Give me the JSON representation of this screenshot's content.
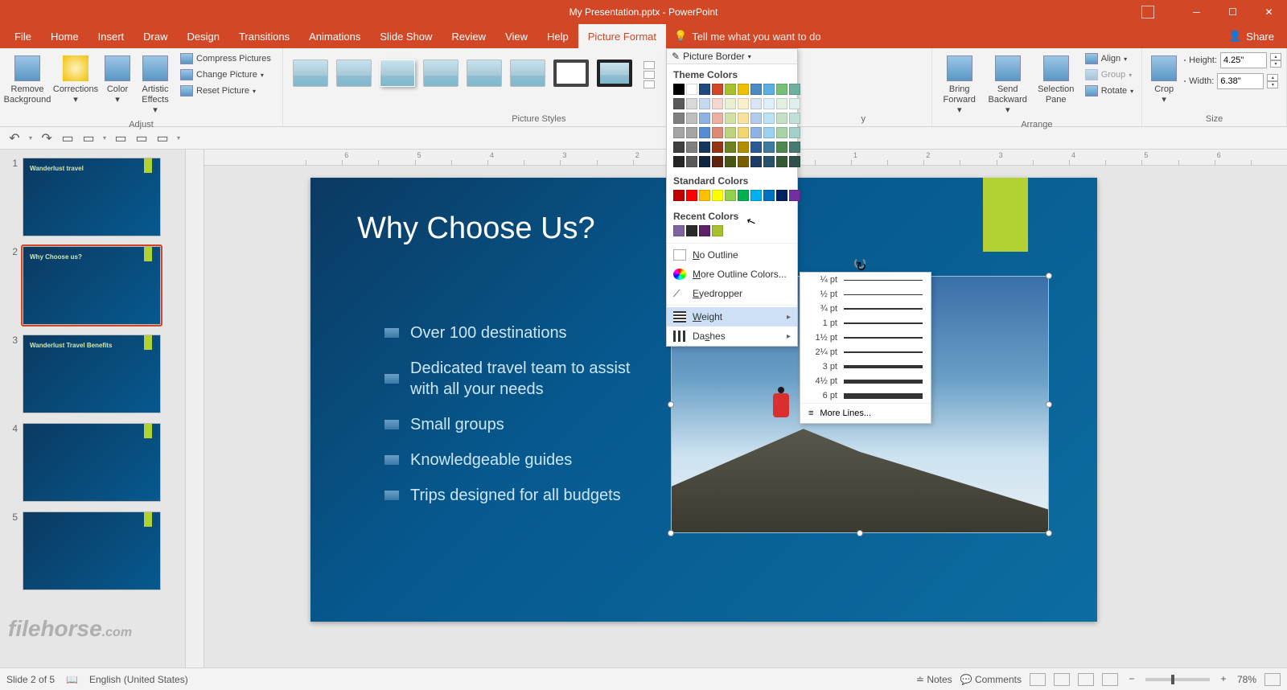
{
  "titlebar": {
    "title": "My Presentation.pptx  -  PowerPoint"
  },
  "menu": {
    "tabs": [
      "File",
      "Home",
      "Insert",
      "Draw",
      "Design",
      "Transitions",
      "Animations",
      "Slide Show",
      "Review",
      "View",
      "Help",
      "Picture Format"
    ],
    "activeTab": "Picture Format",
    "search_placeholder": "Tell me what you want to do",
    "share": "Share"
  },
  "ribbon": {
    "adjust": {
      "label": "Adjust",
      "removeBg": "Remove Background",
      "corrections": "Corrections",
      "color": "Color",
      "artistic": "Artistic Effects",
      "compress": "Compress Pictures",
      "change": "Change Picture",
      "reset": "Reset Picture"
    },
    "styles": {
      "label": "Picture Styles"
    },
    "arrange": {
      "label": "Arrange",
      "bringForward": "Bring Forward",
      "sendBackward": "Send Backward",
      "selectionPane": "Selection Pane",
      "align": "Align",
      "group": "Group",
      "rotate": "Rotate"
    },
    "size": {
      "label": "Size",
      "crop": "Crop",
      "heightLabel": "Height:",
      "heightVal": "4.25\"",
      "widthLabel": "Width:",
      "widthVal": "6.38\""
    }
  },
  "pictureBorder": {
    "button": "Picture Border",
    "themeColorsLabel": "Theme Colors",
    "themeColors": [
      "#000000",
      "#ffffff",
      "#1f497d",
      "#d24726",
      "#a8c030",
      "#f0c000",
      "#4a8bc4",
      "#5ab0e0",
      "#78c078",
      "#70b0a0"
    ],
    "themeTints": [
      [
        "#595959",
        "#d9d9d9",
        "#c6d9f0",
        "#f4d7d0",
        "#e8f0d0",
        "#fbf0cc",
        "#d9e5f3",
        "#def0fa",
        "#e1f0e1",
        "#e0efec"
      ],
      [
        "#7f7f7f",
        "#bfbfbf",
        "#8db3e2",
        "#eab0a2",
        "#d3e1a6",
        "#f7e29e",
        "#b4ccec",
        "#bde1f5",
        "#c5e1c5",
        "#c2e0da"
      ],
      [
        "#a5a5a5",
        "#a5a5a5",
        "#548dd4",
        "#df8974",
        "#bfd27c",
        "#f3d470",
        "#8fb3e5",
        "#9cd2f0",
        "#a8d3a8",
        "#a3d1c8"
      ],
      [
        "#404040",
        "#7f7f7f",
        "#17365d",
        "#943516",
        "#6f8020",
        "#b38f00",
        "#2c5a96",
        "#3d7ba0",
        "#4e8a4e",
        "#477a70"
      ],
      [
        "#262626",
        "#595959",
        "#0f243e",
        "#5e220e",
        "#4a5514",
        "#785f00",
        "#1d3b64",
        "#28526b",
        "#345c34",
        "#2f514a"
      ]
    ],
    "standardLabel": "Standard Colors",
    "standardColors": [
      "#c00000",
      "#ff0000",
      "#ffc000",
      "#ffff00",
      "#92d050",
      "#00b050",
      "#00b0f0",
      "#0070c0",
      "#002060",
      "#7030a0"
    ],
    "recentLabel": "Recent Colors",
    "recentColors": [
      "#8064a2",
      "#2a2a2a",
      "#5f2167",
      "#a8c030"
    ],
    "noOutline": "No Outline",
    "moreColors": "More Outline Colors...",
    "eyedropper": "Eyedropper",
    "weight": "Weight",
    "dashes": "Dashes"
  },
  "weightMenu": {
    "options": [
      {
        "label": "¼ pt",
        "px": 0.5
      },
      {
        "label": "½ pt",
        "px": 1
      },
      {
        "label": "¾ pt",
        "px": 1.25
      },
      {
        "label": "1 pt",
        "px": 1.5
      },
      {
        "label": "1½ pt",
        "px": 2
      },
      {
        "label": "2¼ pt",
        "px": 2.75
      },
      {
        "label": "3 pt",
        "px": 3.5
      },
      {
        "label": "4½ pt",
        "px": 5
      },
      {
        "label": "6 pt",
        "px": 7
      }
    ],
    "moreLines": "More Lines..."
  },
  "slides": [
    {
      "num": 1,
      "title": "Wanderlust travel"
    },
    {
      "num": 2,
      "title": "Why Choose us?",
      "selected": true
    },
    {
      "num": 3,
      "title": "Wanderlust Travel Benefits"
    },
    {
      "num": 4,
      "title": ""
    },
    {
      "num": 5,
      "title": ""
    }
  ],
  "currentSlide": {
    "title": "Why Choose Us?",
    "bullets": [
      "Over 100 destinations",
      "Dedicated travel team to assist with all your needs",
      "Small groups",
      "Knowledgeable guides",
      "Trips designed for all budgets"
    ]
  },
  "status": {
    "slideCount": "Slide 2 of 5",
    "language": "English (United States)",
    "notes": "Notes",
    "comments": "Comments",
    "zoom": "78%"
  },
  "watermark": {
    "brand": "filehorse",
    "suffix": ".com"
  }
}
